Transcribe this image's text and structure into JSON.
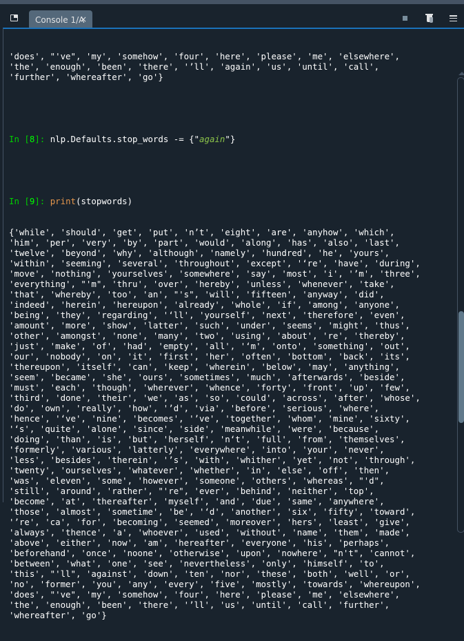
{
  "window": {
    "tab_label": "Console 1/A",
    "tab_close_glyph": "×",
    "toolbar_icons": [
      "window-toggle-icon",
      "stop-icon",
      "trash-icon",
      "menu-icon"
    ]
  },
  "console": {
    "pre_lines": [
      "'does', \"'ve\", 'my', 'somehow', 'four', 'here', 'please', 'me', 'elsewhere',",
      "'the', 'enough', 'been', 'there', '’ll', 'again', 'us', 'until', 'call',",
      "'further', 'whereafter', 'go'}"
    ],
    "cell8": {
      "prompt_in": "In [",
      "prompt_num": "8",
      "prompt_close": "]: ",
      "code_prefix": "nlp.Defaults.stop_words -= {\"",
      "code_string": "again",
      "code_suffix": "\"}"
    },
    "cell9": {
      "prompt_in": "In [",
      "prompt_num": "9",
      "prompt_close": "]: ",
      "code_func": "print",
      "code_args": "(stopwords)"
    },
    "output_lines": [
      "{'while', 'should', 'get', 'put', 'n’t', 'eight', 'are', 'anyhow', 'which',",
      "'him', 'per', 'very', 'by', 'part', 'would', 'along', 'has', 'also', 'last',",
      "'twelve', 'beyond', 'why', 'although', 'namely', 'hundred', 'he', 'yours',",
      "'within', 'seeming', 'several', 'throughout', 'except', '‘re', 'have', 'during',",
      "'move', 'nothing', 'yourselves', 'somewhere', 'say', 'most', 'i', '’m', 'three',",
      "'everything', \"'m\", 'thru', 'over', 'hereby', 'unless', 'whenever', 'take',",
      "'that', 'whereby', 'too', 'an', \"'s\", 'will', 'fifteen', 'anyway', 'did',",
      "'indeed', 'herein', 'hereupon', 'already', 'whole', 'if', 'among', 'anyone',",
      "'being', 'they', 'regarding', '‘ll', 'yourself', 'next', 'therefore', 'even',",
      "'amount', 'more', 'show', 'latter', 'such', 'under', 'seems', 'might', 'thus',",
      "'other', 'amongst', 'none', 'many', 'two', 'using', 'about', 're', 'thereby',",
      "'just', 'make', 'of', 'had', 'empty', 'all', '‘m', 'onto', 'something', 'out',",
      "'our', 'nobody', 'on', 'it', 'first', 'her', 'often', 'bottom', 'back', 'its',",
      "'thereupon', 'itself', 'can', 'keep', 'wherein', 'below', 'may', 'anything',",
      "'seem', 'became', 'she', 'ours', 'sometimes', 'much', 'afterwards', 'beside',",
      "'must', 'each', 'though', 'wherever', 'whence', 'forty', 'front', 'up', 'few',",
      "'third', 'done', 'their', 'we', 'as', 'so', 'could', 'across', 'after', 'whose',",
      "'do', 'own', 'really', 'how', '’d', 'via', 'before', 'serious', 'where',",
      "'hence', '‘ve', 'nine', 'becomes', '’ve', 'together', 'whom', 'mine', 'sixty',",
      "'‘s', 'quite', 'alone', 'since', 'side', 'meanwhile', 'were', 'because',",
      "'doing', 'than', 'is', 'but', 'herself', 'n‘t', 'full', 'from', 'themselves',",
      "'formerly', 'various', 'latterly', 'everywhere', 'into', 'your', 'never',",
      "'less', 'besides', 'therein', '’s', 'with', 'whither', 'yet', 'not', 'through',",
      "'twenty', 'ourselves', 'whatever', 'whether', 'in', 'else', 'off', 'then',",
      "'was', 'eleven', 'some', 'however', 'someone', 'others', 'whereas', \"'d\",",
      "'still', 'around', 'rather', \"'re\", 'ever', 'behind', 'neither', 'top',",
      "'become', 'at', 'thereafter', 'myself', 'and', 'due', 'same', 'anywhere',",
      "'those', 'almost', 'sometime', 'be', '‘d', 'another', 'six', 'fifty', 'toward',",
      "'’re', 'ca', 'for', 'becoming', 'seemed', 'moreover', 'hers', 'least', 'give',",
      "'always', 'thence', 'a', 'whoever', 'used', 'without', 'name', 'them', 'made',",
      "'above', 'either', 'now', 'am', 'hereafter', 'everyone', 'his', 'perhaps',",
      "'beforehand', 'once', 'noone', 'otherwise', 'upon', 'nowhere', \"n't\", 'cannot',",
      "'between', 'what', 'one', 'see', 'nevertheless', 'only', 'himself', 'to',",
      "'this', \"'ll\", 'against', 'down', 'ten', 'nor', 'these', 'both', 'well', 'or',",
      "'no', 'former', 'you', 'any', 'every', 'five', 'mostly', 'towards', 'whereupon',",
      "'does', \"'ve\", 'my', 'somehow', 'four', 'here', 'please', 'me', 'elsewhere',",
      "'the', 'enough', 'been', 'there', '’ll', 'us', 'until', 'call', 'further',",
      "'whereafter', 'go'}"
    ]
  },
  "scrollbar": {
    "position_fraction": 0.55,
    "visible_fraction": 0.25
  },
  "colors": {
    "background": "#19232d",
    "tab_active": "#54687a",
    "accent": "#1a72bb",
    "prompt": "#00ce00",
    "builtin": "#e5964c",
    "string": "#8bc34a",
    "text": "#ffffff"
  }
}
